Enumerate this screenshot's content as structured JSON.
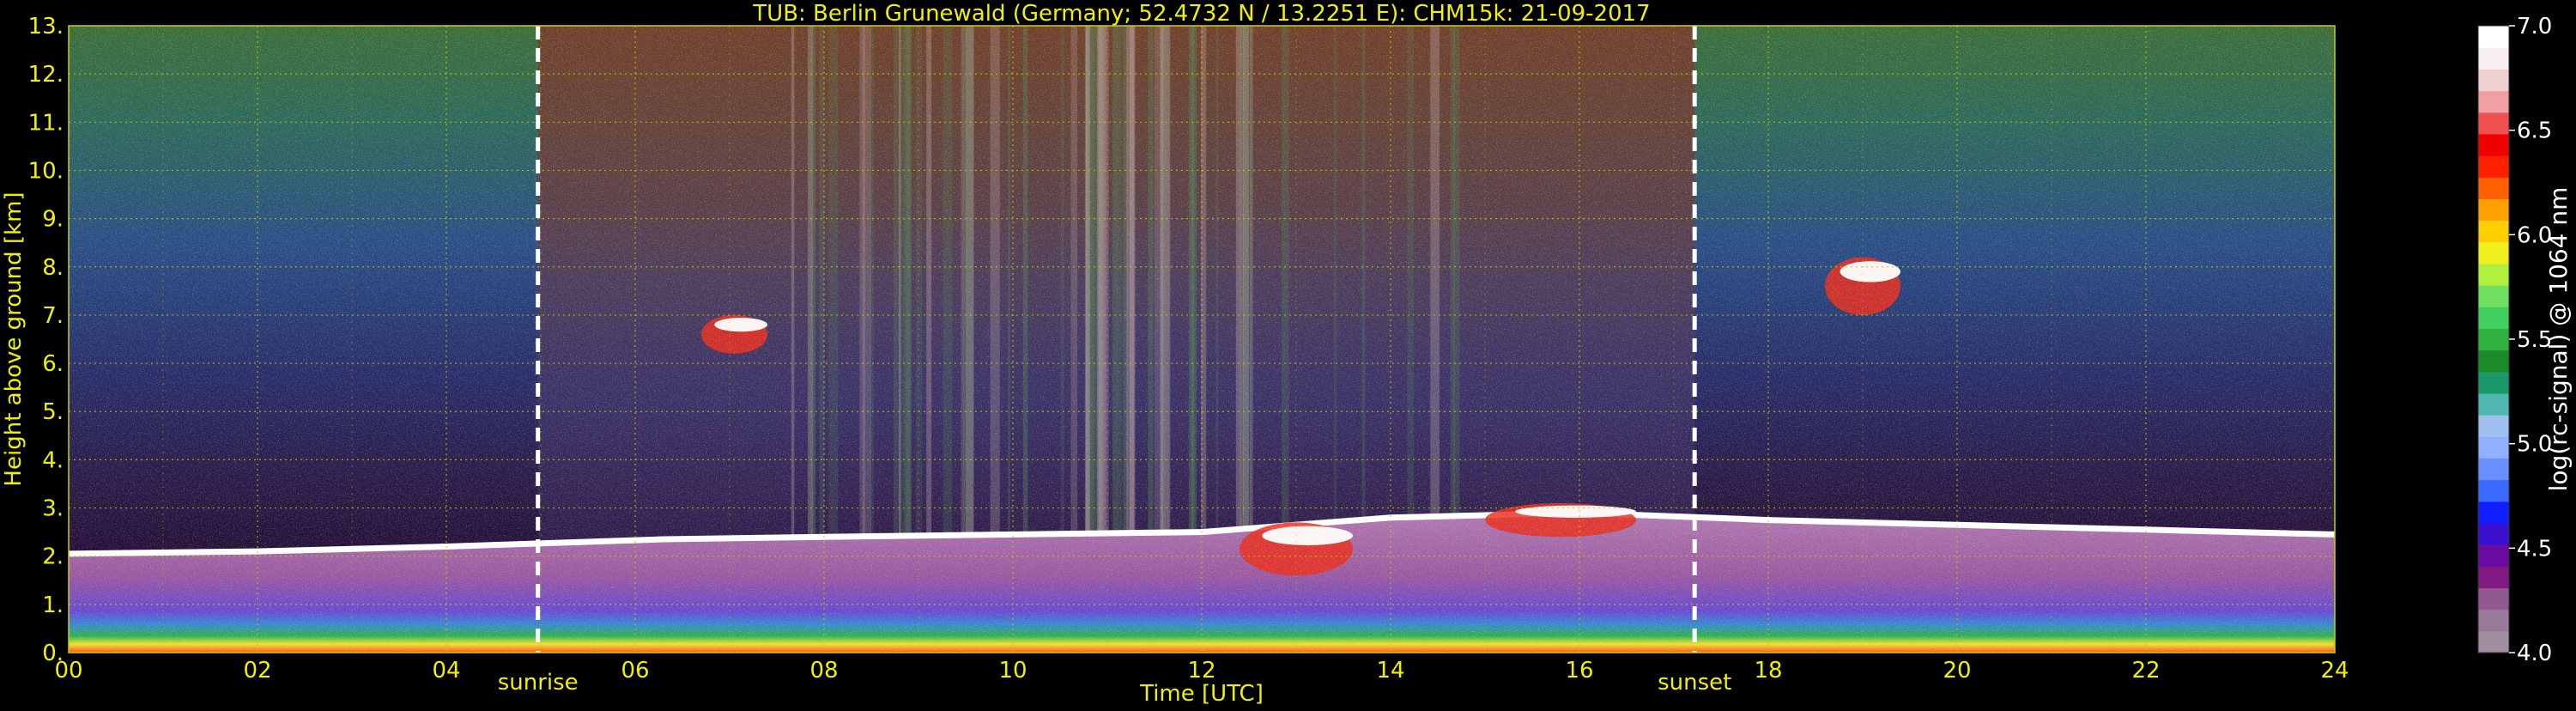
{
  "chart_data": {
    "type": "heatmap",
    "title": "TUB: Berlin Grunewald (Germany; 52.4732 N / 13.2251 E):    CHM15k: 21-09-2017",
    "xlabel": "Time [UTC]",
    "ylabel": "Height above ground [km]",
    "xlim": [
      0,
      24
    ],
    "ylim": [
      0,
      13
    ],
    "x_ticks": [
      "00",
      "02",
      "04",
      "06",
      "08",
      "10",
      "12",
      "14",
      "16",
      "18",
      "20",
      "22",
      "24"
    ],
    "y_ticks": [
      "0.",
      "1.",
      "2.",
      "3.",
      "4.",
      "5.",
      "6.",
      "7.",
      "8.",
      "9.",
      "10.",
      "11.",
      "12.",
      "13."
    ],
    "grid": true,
    "markers": [
      {
        "label": "sunrise",
        "x": 4.97
      },
      {
        "label": "sunset",
        "x": 17.22
      }
    ],
    "colorbar": {
      "label": "log(rc-signal) @ 1064 nm",
      "range": [
        4.0,
        7.0
      ],
      "ticks": [
        "4.0",
        "4.5",
        "5.0",
        "5.5",
        "6.0",
        "6.5",
        "7.0"
      ],
      "colors": [
        "#a08fa0",
        "#9a7a9a",
        "#905a90",
        "#801a80",
        "#6a0aa0",
        "#3a10d0",
        "#1020ff",
        "#3a6aff",
        "#6a90ff",
        "#90b0ff",
        "#a0c0f0",
        "#50b8b0",
        "#1a9a6a",
        "#1a8a2a",
        "#30b040",
        "#40d060",
        "#70e060",
        "#b0f040",
        "#f0f020",
        "#ffd000",
        "#ffa000",
        "#ff6000",
        "#ff2000",
        "#f00000",
        "#f05050",
        "#f0a0a0",
        "#f0d0d0",
        "#f8f0f0",
        "#ffffff"
      ]
    },
    "boundary_layer_top_km": [
      {
        "x": 0,
        "y": 2.05
      },
      {
        "x": 2,
        "y": 2.1
      },
      {
        "x": 4,
        "y": 2.2
      },
      {
        "x": 6.3,
        "y": 2.35
      },
      {
        "x": 8,
        "y": 2.4
      },
      {
        "x": 12,
        "y": 2.5
      },
      {
        "x": 14,
        "y": 2.8
      },
      {
        "x": 16,
        "y": 2.9
      },
      {
        "x": 18,
        "y": 2.75
      },
      {
        "x": 20,
        "y": 2.65
      },
      {
        "x": 22,
        "y": 2.55
      },
      {
        "x": 24,
        "y": 2.45
      }
    ],
    "cloud_patches": [
      {
        "x_start": 6.7,
        "x_end": 7.4,
        "y_start": 6.2,
        "y_end": 7.0
      },
      {
        "x_start": 18.6,
        "x_end": 19.4,
        "y_start": 7.0,
        "y_end": 8.2
      },
      {
        "x_start": 12.4,
        "x_end": 13.6,
        "y_start": 1.6,
        "y_end": 2.7
      },
      {
        "x_start": 15.0,
        "x_end": 16.6,
        "y_start": 2.4,
        "y_end": 3.1
      }
    ]
  }
}
